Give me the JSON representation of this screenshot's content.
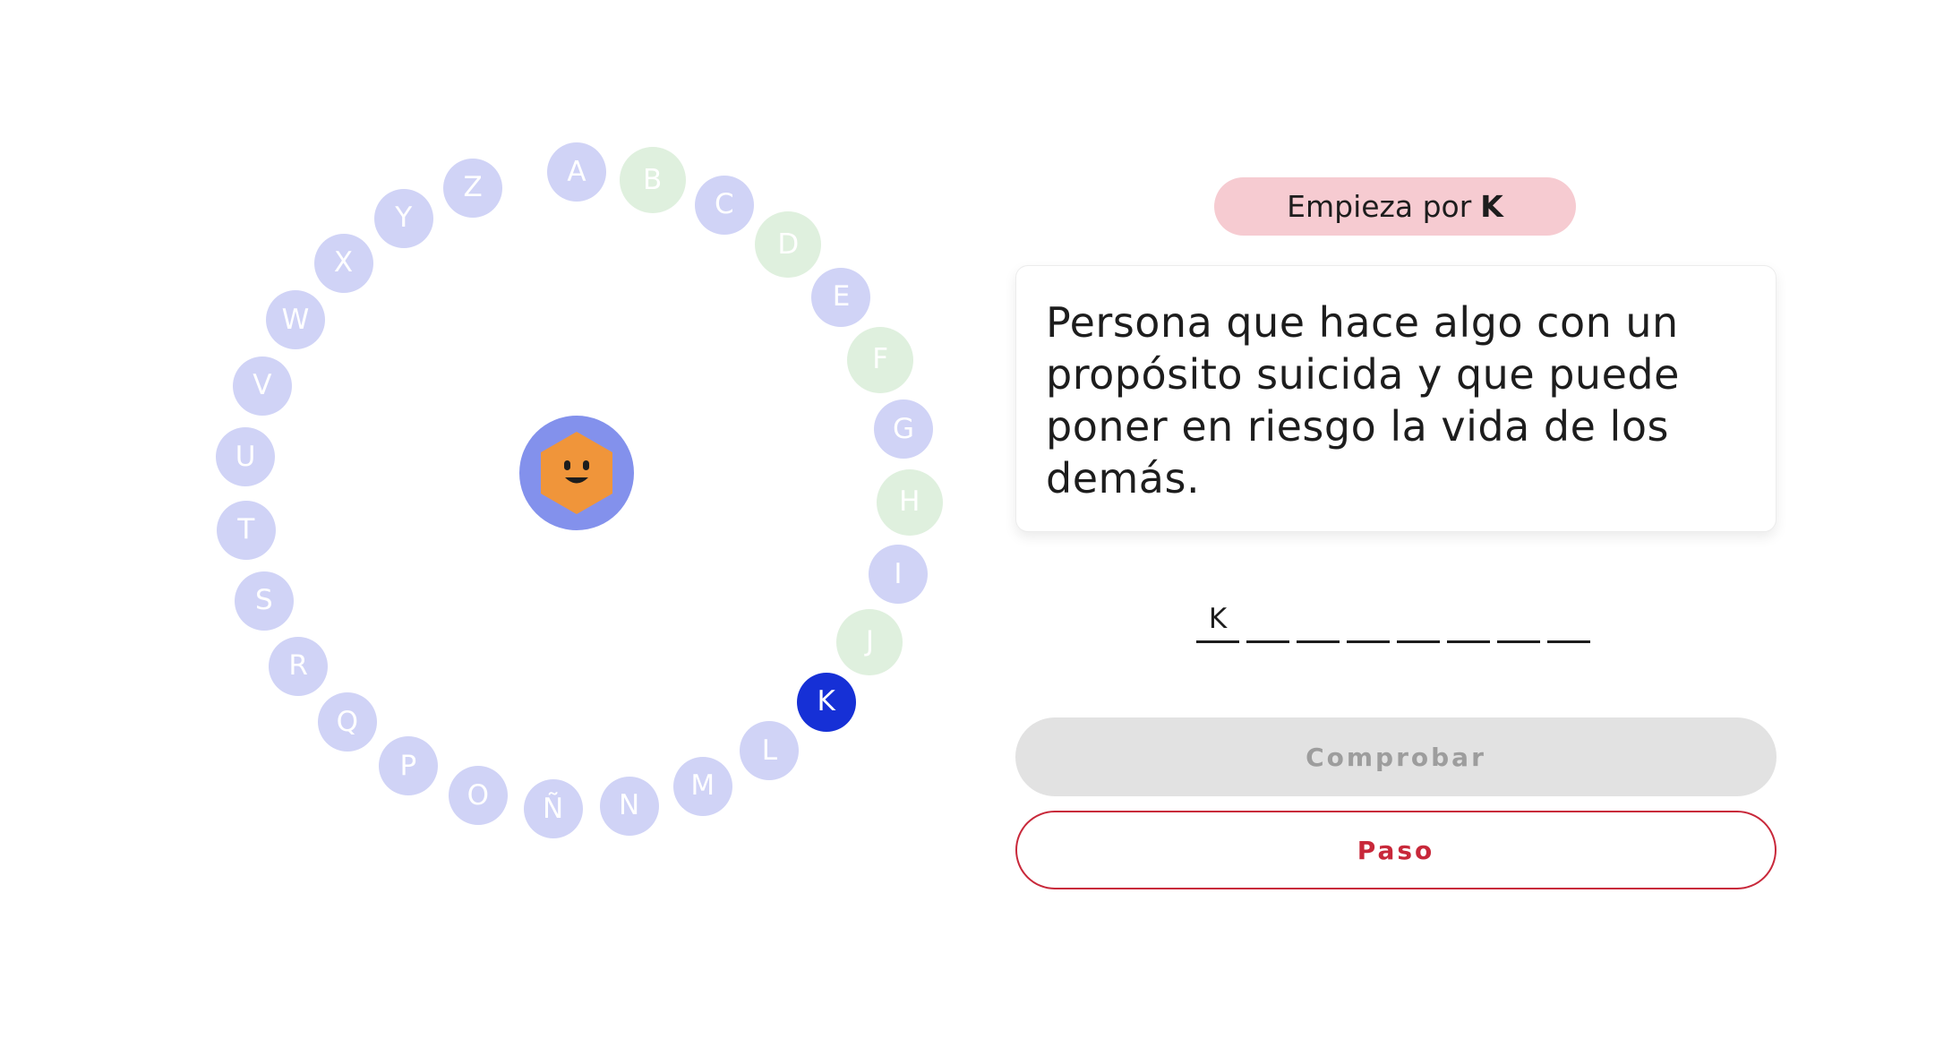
{
  "rosco": {
    "letters": [
      {
        "letter": "A",
        "status": "pending"
      },
      {
        "letter": "B",
        "status": "correct"
      },
      {
        "letter": "C",
        "status": "pending"
      },
      {
        "letter": "D",
        "status": "correct"
      },
      {
        "letter": "E",
        "status": "pending"
      },
      {
        "letter": "F",
        "status": "correct"
      },
      {
        "letter": "G",
        "status": "pending"
      },
      {
        "letter": "H",
        "status": "correct"
      },
      {
        "letter": "I",
        "status": "pending"
      },
      {
        "letter": "J",
        "status": "correct"
      },
      {
        "letter": "K",
        "status": "current"
      },
      {
        "letter": "L",
        "status": "pending"
      },
      {
        "letter": "M",
        "status": "pending"
      },
      {
        "letter": "N",
        "status": "pending"
      },
      {
        "letter": "Ñ",
        "status": "pending"
      },
      {
        "letter": "O",
        "status": "pending"
      },
      {
        "letter": "P",
        "status": "pending"
      },
      {
        "letter": "Q",
        "status": "pending"
      },
      {
        "letter": "R",
        "status": "pending"
      },
      {
        "letter": "S",
        "status": "pending"
      },
      {
        "letter": "T",
        "status": "pending"
      },
      {
        "letter": "U",
        "status": "pending"
      },
      {
        "letter": "V",
        "status": "pending"
      },
      {
        "letter": "W",
        "status": "pending"
      },
      {
        "letter": "X",
        "status": "pending"
      },
      {
        "letter": "Y",
        "status": "pending"
      },
      {
        "letter": "Z",
        "status": "pending"
      }
    ],
    "center_icon": "hexagon-smiley-icon"
  },
  "hint": {
    "prefix": "Empieza por",
    "letter": "K"
  },
  "question": {
    "definition": "Persona que hace algo con un propósito suicida y que puede poner en riesgo la vida de los demás."
  },
  "answer": {
    "slots": [
      "K",
      "",
      "",
      "",
      "",
      "",
      "",
      ""
    ]
  },
  "actions": {
    "check_label": "Comprobar",
    "pass_label": "Paso"
  },
  "colors": {
    "pending": "#d0d3f6",
    "correct": "#dff0de",
    "current": "#1630d6",
    "center_badge": "#8391ec",
    "hexagon": "#f0953a",
    "hint_background": "#f6cbd1",
    "pass_accent": "#c8283a",
    "check_disabled": "#e2e2e2"
  }
}
